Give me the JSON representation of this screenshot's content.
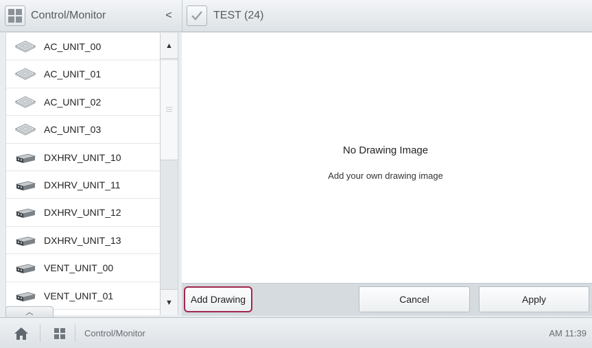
{
  "header": {
    "left_title": "Control/Monitor",
    "collapse_glyph": "<",
    "right_title": "TEST (24)"
  },
  "devices": [
    {
      "name": "AC_UNIT_00",
      "icon": "cassette-ac-icon"
    },
    {
      "name": "AC_UNIT_01",
      "icon": "cassette-ac-icon"
    },
    {
      "name": "AC_UNIT_02",
      "icon": "cassette-ac-icon"
    },
    {
      "name": "AC_UNIT_03",
      "icon": "cassette-ac-icon"
    },
    {
      "name": "DXHRV_UNIT_10",
      "icon": "ventilation-unit-icon"
    },
    {
      "name": "DXHRV_UNIT_11",
      "icon": "ventilation-unit-icon"
    },
    {
      "name": "DXHRV_UNIT_12",
      "icon": "ventilation-unit-icon"
    },
    {
      "name": "DXHRV_UNIT_13",
      "icon": "ventilation-unit-icon"
    },
    {
      "name": "VENT_UNIT_00",
      "icon": "ventilation-unit-icon"
    },
    {
      "name": "VENT_UNIT_01",
      "icon": "ventilation-unit-icon"
    }
  ],
  "scrollbar": {
    "up_glyph": "▲",
    "down_glyph": "▼"
  },
  "panel_expand_glyph": "︿",
  "drawing": {
    "empty_title": "No Drawing Image",
    "empty_subtitle": "Add your own drawing image"
  },
  "actions": {
    "add_label": "Add Drawing",
    "cancel_label": "Cancel",
    "apply_label": "Apply",
    "highlight_color": "#a2254d"
  },
  "footer": {
    "label": "Control/Monitor",
    "time": "AM 11:39"
  }
}
